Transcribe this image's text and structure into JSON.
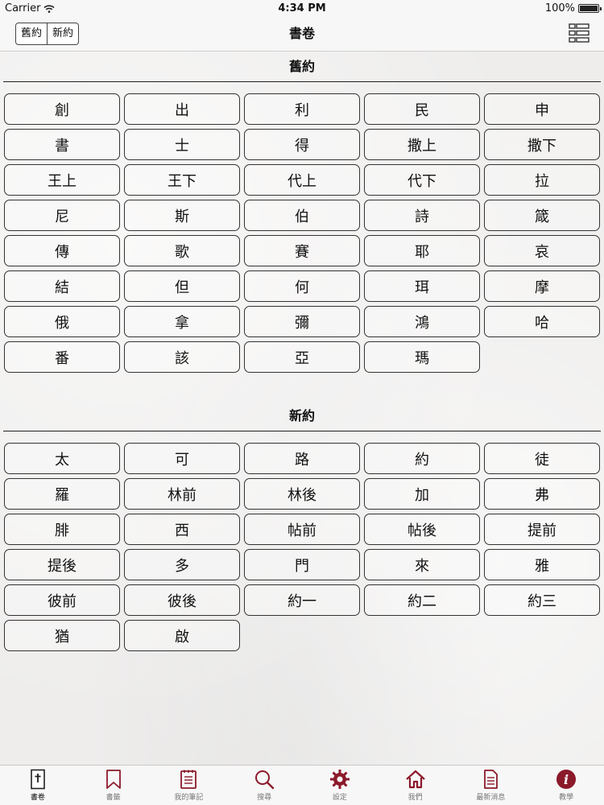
{
  "status": {
    "carrier": "Carrier",
    "time": "4:34 PM",
    "battery": "100%"
  },
  "nav": {
    "segments": [
      "舊約",
      "新約"
    ],
    "title": "書卷"
  },
  "old_testament": {
    "header": "舊約",
    "books": [
      "創",
      "出",
      "利",
      "民",
      "申",
      "書",
      "士",
      "得",
      "撒上",
      "撒下",
      "王上",
      "王下",
      "代上",
      "代下",
      "拉",
      "尼",
      "斯",
      "伯",
      "詩",
      "箴",
      "傳",
      "歌",
      "賽",
      "耶",
      "哀",
      "結",
      "但",
      "何",
      "珥",
      "摩",
      "俄",
      "拿",
      "彌",
      "鴻",
      "哈",
      "番",
      "該",
      "亞",
      "瑪"
    ]
  },
  "new_testament": {
    "header": "新約",
    "books": [
      "太",
      "可",
      "路",
      "約",
      "徒",
      "羅",
      "林前",
      "林後",
      "加",
      "弗",
      "腓",
      "西",
      "帖前",
      "帖後",
      "提前",
      "提後",
      "多",
      "門",
      "來",
      "雅",
      "彼前",
      "彼後",
      "約一",
      "約二",
      "約三",
      "猶",
      "啟"
    ]
  },
  "tabs": [
    {
      "label": "書卷",
      "icon": "bible-book-icon"
    },
    {
      "label": "書籤",
      "icon": "bookmark-icon"
    },
    {
      "label": "我的筆記",
      "icon": "notepad-icon"
    },
    {
      "label": "搜尋",
      "icon": "search-icon"
    },
    {
      "label": "設定",
      "icon": "gear-icon"
    },
    {
      "label": "我們",
      "icon": "home-icon"
    },
    {
      "label": "最新消息",
      "icon": "document-icon"
    },
    {
      "label": "教學",
      "icon": "info-icon"
    }
  ],
  "colors": {
    "accent": "#8b1a2b"
  }
}
